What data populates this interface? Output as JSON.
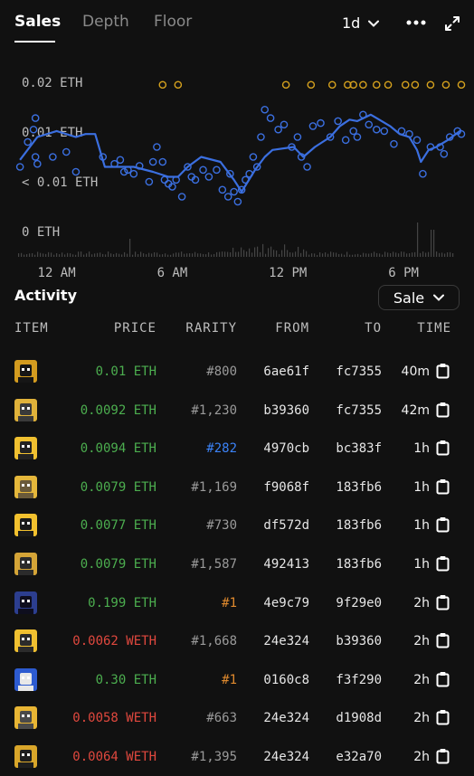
{
  "tabs": [
    {
      "label": "Sales"
    },
    {
      "label": "Depth"
    },
    {
      "label": "Floor"
    }
  ],
  "period": "1d",
  "chart_data": {
    "type": "scatter",
    "y_tick_labels": [
      "0.02 ETH",
      "0.01 ETH",
      "< 0.01 ETH",
      "0 ETH"
    ],
    "x_tick_labels": [
      "12 AM",
      "6 AM",
      "12 PM",
      "6 PM"
    ],
    "colors": {
      "sales": "#3b6fe0",
      "offers": "#d6a21e",
      "volume": "#444444"
    },
    "x_range_hours": [
      -2,
      21
    ],
    "series": [
      {
        "points": [
          [
            -1.9,
            0.0065
          ],
          [
            -1.5,
            0.009
          ],
          [
            -1.2,
            0.0105
          ],
          [
            -1.1,
            0.0128
          ],
          [
            -1.1,
            0.0075
          ],
          [
            -1.0,
            0.0068
          ],
          [
            -0.2,
            0.0075
          ],
          [
            0.5,
            0.008
          ],
          [
            1.0,
            0.006
          ],
          [
            2.4,
            0.0075
          ],
          [
            3.0,
            0.0068
          ],
          [
            3.3,
            0.0072
          ],
          [
            3.5,
            0.006
          ],
          [
            3.7,
            0.0062
          ],
          [
            4.0,
            0.0058
          ],
          [
            4.3,
            0.0066
          ],
          [
            4.8,
            0.005
          ],
          [
            5.0,
            0.007
          ],
          [
            5.2,
            0.0085
          ],
          [
            5.5,
            0.007
          ],
          [
            5.6,
            0.0052
          ],
          [
            5.8,
            0.0048
          ],
          [
            6.0,
            0.0045
          ],
          [
            6.2,
            0.0052
          ],
          [
            6.5,
            0.0035
          ],
          [
            6.8,
            0.0065
          ],
          [
            7.0,
            0.0055
          ],
          [
            7.2,
            0.0052
          ],
          [
            7.6,
            0.0062
          ],
          [
            7.9,
            0.0055
          ],
          [
            8.3,
            0.0062
          ],
          [
            8.6,
            0.0042
          ],
          [
            8.9,
            0.0035
          ],
          [
            9.0,
            0.0058
          ],
          [
            9.2,
            0.004
          ],
          [
            9.4,
            0.003
          ],
          [
            9.6,
            0.0042
          ],
          [
            9.8,
            0.0052
          ],
          [
            10.0,
            0.0058
          ],
          [
            10.2,
            0.0075
          ],
          [
            10.4,
            0.0065
          ],
          [
            10.6,
            0.0095
          ],
          [
            10.8,
            0.0145
          ],
          [
            11.1,
            0.0128
          ],
          [
            11.5,
            0.0105
          ],
          [
            11.8,
            0.0115
          ],
          [
            12.2,
            0.0085
          ],
          [
            12.5,
            0.0095
          ],
          [
            12.7,
            0.0075
          ],
          [
            13.0,
            0.0065
          ],
          [
            13.3,
            0.0112
          ],
          [
            13.7,
            0.0118
          ],
          [
            14.2,
            0.0095
          ],
          [
            14.6,
            0.0122
          ],
          [
            15.0,
            0.0092
          ],
          [
            15.4,
            0.0102
          ],
          [
            15.6,
            0.0095
          ],
          [
            15.9,
            0.0135
          ],
          [
            16.2,
            0.0115
          ],
          [
            16.6,
            0.0105
          ],
          [
            17.0,
            0.0102
          ],
          [
            17.5,
            0.0088
          ],
          [
            17.9,
            0.0102
          ],
          [
            18.3,
            0.0098
          ],
          [
            18.7,
            0.0092
          ],
          [
            19.0,
            0.0058
          ],
          [
            19.4,
            0.0085
          ],
          [
            19.9,
            0.0085
          ],
          [
            20.1,
            0.0078
          ],
          [
            20.4,
            0.0095
          ],
          [
            20.8,
            0.0102
          ],
          [
            21.0,
            0.0098
          ]
        ]
      },
      {
        "points": [
          [
            5.5,
            0.0195
          ],
          [
            6.3,
            0.0195
          ],
          [
            11.9,
            0.0195
          ],
          [
            13.2,
            0.0195
          ],
          [
            14.3,
            0.0195
          ],
          [
            15.1,
            0.0195
          ],
          [
            15.4,
            0.0195
          ],
          [
            15.9,
            0.0195
          ],
          [
            16.6,
            0.0195
          ],
          [
            17.2,
            0.0195
          ],
          [
            18.1,
            0.0195
          ],
          [
            18.6,
            0.0195
          ],
          [
            19.4,
            0.0195
          ],
          [
            20.2,
            0.0195
          ],
          [
            21.0,
            0.0195
          ]
        ]
      }
    ],
    "avg_line": [
      [
        -1.9,
        0.0072
      ],
      [
        -1.0,
        0.0095
      ],
      [
        0.0,
        0.0102
      ],
      [
        1.0,
        0.0095
      ],
      [
        1.5,
        0.0098
      ],
      [
        2.0,
        0.0098
      ],
      [
        2.5,
        0.0065
      ],
      [
        3.2,
        0.0065
      ],
      [
        4.0,
        0.0065
      ],
      [
        5.0,
        0.006
      ],
      [
        5.8,
        0.0055
      ],
      [
        6.3,
        0.0055
      ],
      [
        6.8,
        0.0065
      ],
      [
        7.5,
        0.0075
      ],
      [
        8.5,
        0.007
      ],
      [
        9.2,
        0.0052
      ],
      [
        9.6,
        0.004
      ],
      [
        10.3,
        0.0062
      ],
      [
        10.8,
        0.0075
      ],
      [
        11.2,
        0.0082
      ],
      [
        12.3,
        0.0085
      ],
      [
        12.8,
        0.0075
      ],
      [
        13.4,
        0.0085
      ],
      [
        14.2,
        0.0095
      ],
      [
        14.7,
        0.0112
      ],
      [
        15.2,
        0.0125
      ],
      [
        15.6,
        0.0122
      ],
      [
        16.3,
        0.0135
      ],
      [
        16.6,
        0.0128
      ],
      [
        17.3,
        0.0112
      ],
      [
        17.8,
        0.0098
      ],
      [
        18.3,
        0.0095
      ],
      [
        18.7,
        0.0082
      ],
      [
        18.9,
        0.007
      ],
      [
        19.3,
        0.0082
      ],
      [
        19.7,
        0.0085
      ],
      [
        20.3,
        0.0092
      ],
      [
        21.0,
        0.0104
      ]
    ]
  },
  "activity": {
    "title": "Activity",
    "filter": "Sale",
    "columns": [
      "ITEM",
      "PRICE",
      "RARITY",
      "FROM",
      "TO",
      "TIME"
    ],
    "rows": [
      {
        "price": "0.01 ETH",
        "price_color": "#4cae4f",
        "rarity": "#800",
        "rarity_color": "#9a9a9a",
        "from": "6ae61f",
        "to": "fc7355",
        "time": "40m",
        "avatar_bg": "#d39b1f",
        "avatar_fg": "#161616"
      },
      {
        "price": "0.0092 ETH",
        "price_color": "#4cae4f",
        "rarity": "#1,230",
        "rarity_color": "#9a9a9a",
        "from": "b39360",
        "to": "fc7355",
        "time": "42m",
        "avatar_bg": "#e0b23a",
        "avatar_fg": "#3a3a3a"
      },
      {
        "price": "0.0094 ETH",
        "price_color": "#4cae4f",
        "rarity": "#282",
        "rarity_color": "#3b82f6",
        "from": "4970cb",
        "to": "bc383f",
        "time": "1h",
        "avatar_bg": "#f0c030",
        "avatar_fg": "#222222"
      },
      {
        "price": "0.0079 ETH",
        "price_color": "#4cae4f",
        "rarity": "#1,169",
        "rarity_color": "#9a9a9a",
        "from": "f9068f",
        "to": "183fb6",
        "time": "1h",
        "avatar_bg": "#e5b73b",
        "avatar_fg": "#6a5a3a"
      },
      {
        "price": "0.0077 ETH",
        "price_color": "#4cae4f",
        "rarity": "#730",
        "rarity_color": "#9a9a9a",
        "from": "df572d",
        "to": "183fb6",
        "time": "1h",
        "avatar_bg": "#f2c12e",
        "avatar_fg": "#1a1a1a"
      },
      {
        "price": "0.0079 ETH",
        "price_color": "#4cae4f",
        "rarity": "#1,587",
        "rarity_color": "#9a9a9a",
        "from": "492413",
        "to": "183fb6",
        "time": "1h",
        "avatar_bg": "#d4a437",
        "avatar_fg": "#2b2b2b"
      },
      {
        "price": "0.199 ETH",
        "price_color": "#4cae4f",
        "rarity": "#1",
        "rarity_color": "#e08a2e",
        "from": "4e9c79",
        "to": "9f29e0",
        "time": "2h",
        "avatar_bg": "#2c3e8f",
        "avatar_fg": "#0e0e1e"
      },
      {
        "price": "0.0062 WETH",
        "price_color": "#e0483e",
        "rarity": "#1,668",
        "rarity_color": "#9a9a9a",
        "from": "24e324",
        "to": "b39360",
        "time": "2h",
        "avatar_bg": "#f0c030",
        "avatar_fg": "#2b2b2b"
      },
      {
        "price": "0.30 ETH",
        "price_color": "#4cae4f",
        "rarity": "#1",
        "rarity_color": "#e08a2e",
        "from": "0160c8",
        "to": "f3f290",
        "time": "2h",
        "avatar_bg": "#2d5bd0",
        "avatar_fg": "#e8e8e8"
      },
      {
        "price": "0.0058 WETH",
        "price_color": "#e0483e",
        "rarity": "#663",
        "rarity_color": "#9a9a9a",
        "from": "24e324",
        "to": "d1908d",
        "time": "2h",
        "avatar_bg": "#e8b534",
        "avatar_fg": "#4a4a4a"
      },
      {
        "price": "0.0064 WETH",
        "price_color": "#e0483e",
        "rarity": "#1,395",
        "rarity_color": "#9a9a9a",
        "from": "24e324",
        "to": "e32a70",
        "time": "2h",
        "avatar_bg": "#d9a62a",
        "avatar_fg": "#1e1e1e"
      }
    ]
  }
}
